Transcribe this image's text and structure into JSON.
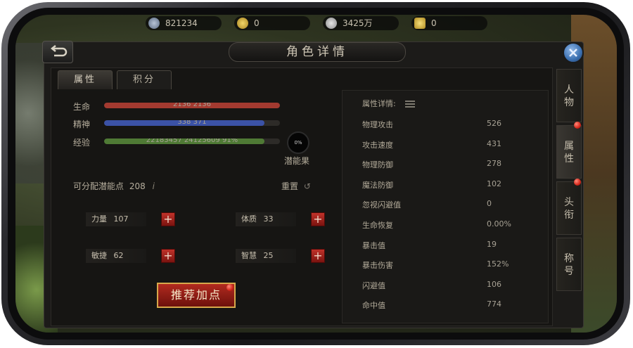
{
  "resources": [
    {
      "icon": "globe-coin-icon",
      "value": "821234"
    },
    {
      "icon": "gold-coin-icon",
      "value": "0"
    },
    {
      "icon": "silver-coin-icon",
      "value": "3425万"
    },
    {
      "icon": "gem-icon",
      "value": "0"
    }
  ],
  "window": {
    "title": "角色详情"
  },
  "tabs": [
    {
      "label": "属性",
      "active": true
    },
    {
      "label": "积分",
      "active": false
    }
  ],
  "bars": {
    "hp": {
      "label": "生命",
      "text": "2136 2136",
      "fraction": 1.0,
      "color": "#a33a30"
    },
    "mp": {
      "label": "精神",
      "text": "338 371",
      "fraction": 0.91,
      "color": "#3b52a6"
    },
    "exp": {
      "label": "经验",
      "text": "22183457 24125609 91%",
      "fraction": 0.91,
      "color": "#4f7a35"
    }
  },
  "potential": {
    "percent": "0%",
    "label": "潜能果"
  },
  "points": {
    "label": "可分配潜能点",
    "value": "208"
  },
  "reset_label": "重置",
  "stats": [
    {
      "name": "力量",
      "value": "107"
    },
    {
      "name": "体质",
      "value": "33"
    },
    {
      "name": "敏捷",
      "value": "62"
    },
    {
      "name": "智慧",
      "value": "25"
    }
  ],
  "recommend_button": "推荐加点",
  "details": {
    "header": "属性详情:",
    "rows": [
      {
        "name": "物理攻击",
        "value": "526"
      },
      {
        "name": "攻击速度",
        "value": "431"
      },
      {
        "name": "物理防御",
        "value": "278"
      },
      {
        "name": "魔法防御",
        "value": "102"
      },
      {
        "name": "忽视闪避值",
        "value": "0"
      },
      {
        "name": "生命恢复",
        "value": "0.00%"
      },
      {
        "name": "暴击值",
        "value": "19"
      },
      {
        "name": "暴击伤害",
        "value": "152%"
      },
      {
        "name": "闪避值",
        "value": "106"
      },
      {
        "name": "命中值",
        "value": "774"
      }
    ]
  },
  "side_tabs": [
    {
      "chars": [
        "人",
        "物"
      ],
      "active": false
    },
    {
      "chars": [
        "属",
        "性"
      ],
      "active": true
    },
    {
      "chars": [
        "头",
        "衔"
      ],
      "active": false
    },
    {
      "chars": [
        "称",
        "号"
      ],
      "active": false
    }
  ],
  "plus_symbol": "+"
}
